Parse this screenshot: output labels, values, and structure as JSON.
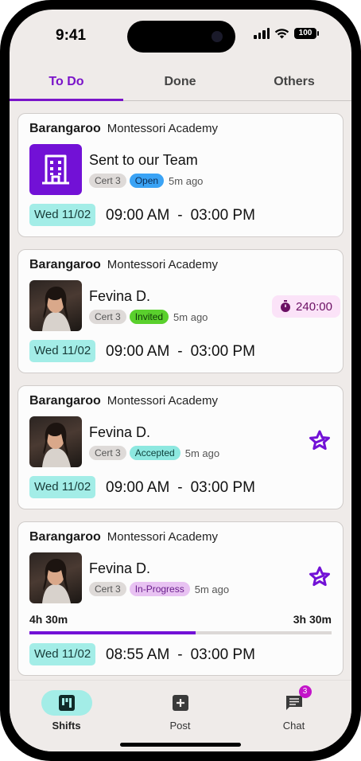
{
  "status_bar": {
    "time": "9:41",
    "battery": "100"
  },
  "tabs": [
    {
      "label": "To Do",
      "active": true
    },
    {
      "label": "Done",
      "active": false
    },
    {
      "label": "Others",
      "active": false
    }
  ],
  "shifts": [
    {
      "organization": "Barangaroo",
      "school": "Montessori Academy",
      "assignee": "Sent to our Team",
      "avatar": "building-icon",
      "cert": "Cert 3",
      "status": "Open",
      "ago": "5m ago",
      "date": "Wed 11/02",
      "start": "09:00 AM",
      "separator": "-",
      "end": "03:00 PM"
    },
    {
      "organization": "Barangaroo",
      "school": "Montessori Academy",
      "assignee": "Fevina D.",
      "avatar": "person-photo",
      "cert": "Cert 3",
      "status": "Invited",
      "ago": "5m ago",
      "timer": "240:00",
      "date": "Wed 11/02",
      "start": "09:00 AM",
      "separator": "-",
      "end": "03:00 PM"
    },
    {
      "organization": "Barangaroo",
      "school": "Montessori Academy",
      "assignee": "Fevina D.",
      "avatar": "person-photo",
      "cert": "Cert 3",
      "status": "Accepted",
      "ago": "5m ago",
      "icon": "star-badge-icon",
      "date": "Wed 11/02",
      "start": "09:00 AM",
      "separator": "-",
      "end": "03:00 PM"
    },
    {
      "organization": "Barangaroo",
      "school": "Montessori Academy",
      "assignee": "Fevina D.",
      "avatar": "person-photo",
      "cert": "Cert 3",
      "status": "In-Progress",
      "ago": "5m ago",
      "icon": "star-badge-icon",
      "elapsed": "4h 30m",
      "remaining": "3h 30m",
      "progress_percent": 55,
      "date": "Wed 11/02",
      "start": "08:55 AM",
      "separator": "-",
      "end": "03:00 PM"
    }
  ],
  "bottom_nav": [
    {
      "label": "Shifts",
      "icon": "shifts-board-icon",
      "active": true
    },
    {
      "label": "Post",
      "icon": "plus-square-icon",
      "active": false
    },
    {
      "label": "Chat",
      "icon": "chat-icon",
      "active": false,
      "badge": "3"
    }
  ],
  "colors": {
    "accent": "#7211d6",
    "teal": "#a3ede7",
    "open": "#3aa3f5",
    "invited": "#5ad02d",
    "accepted": "#8de8e0",
    "in_progress": "#e8c2f2"
  }
}
